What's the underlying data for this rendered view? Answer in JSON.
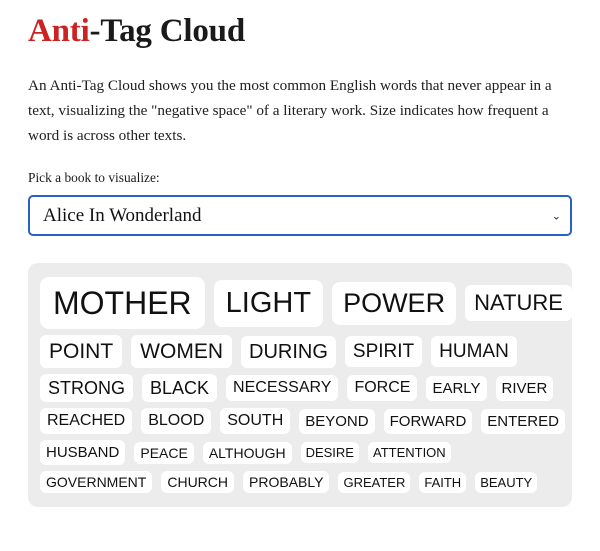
{
  "title": {
    "accent": "Anti",
    "rest": "-Tag Cloud",
    "accent_color": "#cc2222"
  },
  "intro": "An Anti-Tag Cloud shows you the most common English words that never appear in a text, visualizing the \"negative space\" of a literary work. Size indicates how frequent a word is across other texts.",
  "picker": {
    "label": "Pick a book to visualize:",
    "selected": "Alice In Wonderland",
    "chevron": "⌄",
    "border_color": "#2b60c8"
  },
  "cloud": {
    "background": "#ececec",
    "chip_background": "#ffffff",
    "rows": [
      {
        "words": [
          {
            "text": "MOTHER",
            "size": 32
          },
          {
            "text": "LIGHT",
            "size": 29
          },
          {
            "text": "POWER",
            "size": 27
          },
          {
            "text": "NATURE",
            "size": 22
          }
        ]
      },
      {
        "words": [
          {
            "text": "POINT",
            "size": 21
          },
          {
            "text": "WOMEN",
            "size": 21
          },
          {
            "text": "DURING",
            "size": 20
          },
          {
            "text": "SPIRIT",
            "size": 19
          },
          {
            "text": "HUMAN",
            "size": 19
          }
        ]
      },
      {
        "words": [
          {
            "text": "STRONG",
            "size": 18
          },
          {
            "text": "BLACK",
            "size": 18
          },
          {
            "text": "NECESSARY",
            "size": 16
          },
          {
            "text": "FORCE",
            "size": 16
          },
          {
            "text": "EARLY",
            "size": 15
          },
          {
            "text": "RIVER",
            "size": 15
          }
        ]
      },
      {
        "words": [
          {
            "text": "REACHED",
            "size": 16
          },
          {
            "text": "BLOOD",
            "size": 16
          },
          {
            "text": "SOUTH",
            "size": 16
          },
          {
            "text": "BEYOND",
            "size": 15
          },
          {
            "text": "FORWARD",
            "size": 15
          },
          {
            "text": "ENTERED",
            "size": 15
          }
        ]
      },
      {
        "words": [
          {
            "text": "HUSBAND",
            "size": 15
          },
          {
            "text": "PEACE",
            "size": 14
          },
          {
            "text": "ALTHOUGH",
            "size": 14
          },
          {
            "text": "DESIRE",
            "size": 13
          },
          {
            "text": "ATTENTION",
            "size": 13
          }
        ]
      },
      {
        "words": [
          {
            "text": "GOVERNMENT",
            "size": 14
          },
          {
            "text": "CHURCH",
            "size": 14
          },
          {
            "text": "PROBABLY",
            "size": 14
          },
          {
            "text": "GREATER",
            "size": 13
          },
          {
            "text": "FAITH",
            "size": 13
          },
          {
            "text": "BEAUTY",
            "size": 13
          }
        ]
      }
    ]
  }
}
